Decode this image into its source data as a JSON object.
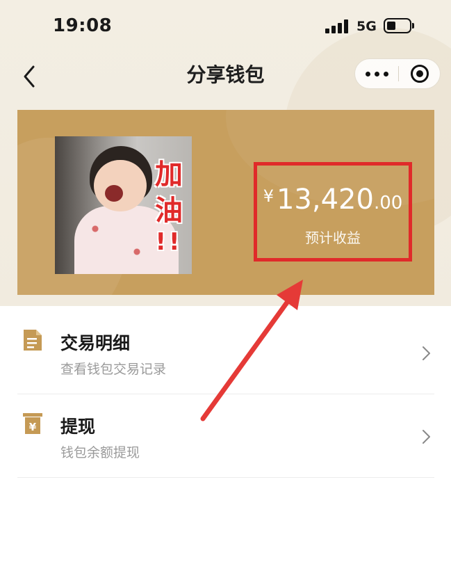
{
  "status_bar": {
    "time": "19:08",
    "network": "5G"
  },
  "nav": {
    "title": "分享钱包",
    "back_icon": "chevron-left-icon",
    "more_icon": "more-dots-icon",
    "close_icon": "target-icon"
  },
  "wallet": {
    "meme_text_1": "加",
    "meme_text_2": "油",
    "meme_text_3": "!!",
    "currency_symbol": "¥",
    "amount_integer": "13,420",
    "amount_decimal": ".00",
    "amount_label": "预计收益"
  },
  "menu": [
    {
      "icon": "document-icon",
      "title": "交易明细",
      "subtitle": "查看钱包交易记录"
    },
    {
      "icon": "withdraw-icon",
      "title": "提现",
      "subtitle": "钱包余额提现"
    }
  ],
  "colors": {
    "card": "#c79f5e",
    "accent_red": "#e02a2a",
    "icon_gold": "#c59a55",
    "background": "#f3eee3"
  }
}
